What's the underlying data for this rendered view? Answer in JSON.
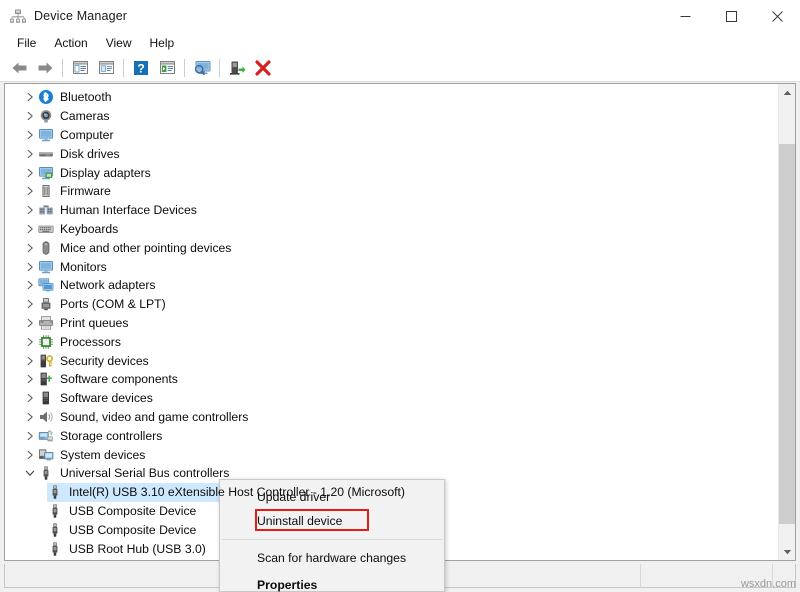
{
  "window": {
    "title": "Device Manager",
    "icon": "device-manager-icon",
    "controls": {
      "minimize": "minimize-icon",
      "maximize": "maximize-icon",
      "close": "close-icon"
    }
  },
  "menubar": {
    "items": [
      {
        "label": "File"
      },
      {
        "label": "Action"
      },
      {
        "label": "View"
      },
      {
        "label": "Help"
      }
    ]
  },
  "toolbar": {
    "buttons": [
      {
        "name": "back-icon"
      },
      {
        "name": "forward-icon"
      },
      {
        "name": "separator"
      },
      {
        "name": "properties-icon"
      },
      {
        "name": "help-topics-icon"
      },
      {
        "name": "separator"
      },
      {
        "name": "help-icon"
      },
      {
        "name": "update-driver-icon"
      },
      {
        "name": "separator"
      },
      {
        "name": "scan-hardware-changes-icon"
      },
      {
        "name": "separator"
      },
      {
        "name": "enable-device-icon"
      },
      {
        "name": "uninstall-device-icon"
      }
    ]
  },
  "tree": {
    "nodes": [
      {
        "label": "Bluetooth",
        "icon": "bluetooth-icon",
        "expand": "collapsed",
        "level": 1,
        "selected": false
      },
      {
        "label": "Cameras",
        "icon": "camera-icon",
        "expand": "collapsed",
        "level": 1,
        "selected": false
      },
      {
        "label": "Computer",
        "icon": "computer-icon",
        "expand": "collapsed",
        "level": 1,
        "selected": false
      },
      {
        "label": "Disk drives",
        "icon": "disk-drive-icon",
        "expand": "collapsed",
        "level": 1,
        "selected": false
      },
      {
        "label": "Display adapters",
        "icon": "display-adapter-icon",
        "expand": "collapsed",
        "level": 1,
        "selected": false
      },
      {
        "label": "Firmware",
        "icon": "firmware-icon",
        "expand": "collapsed",
        "level": 1,
        "selected": false
      },
      {
        "label": "Human Interface Devices",
        "icon": "hid-icon",
        "expand": "collapsed",
        "level": 1,
        "selected": false
      },
      {
        "label": "Keyboards",
        "icon": "keyboard-icon",
        "expand": "collapsed",
        "level": 1,
        "selected": false
      },
      {
        "label": "Mice and other pointing devices",
        "icon": "mouse-icon",
        "expand": "collapsed",
        "level": 1,
        "selected": false
      },
      {
        "label": "Monitors",
        "icon": "monitor-icon",
        "expand": "collapsed",
        "level": 1,
        "selected": false
      },
      {
        "label": "Network adapters",
        "icon": "network-adapter-icon",
        "expand": "collapsed",
        "level": 1,
        "selected": false
      },
      {
        "label": "Ports (COM & LPT)",
        "icon": "port-icon",
        "expand": "collapsed",
        "level": 1,
        "selected": false
      },
      {
        "label": "Print queues",
        "icon": "printer-icon",
        "expand": "collapsed",
        "level": 1,
        "selected": false
      },
      {
        "label": "Processors",
        "icon": "processor-icon",
        "expand": "collapsed",
        "level": 1,
        "selected": false
      },
      {
        "label": "Security devices",
        "icon": "security-device-icon",
        "expand": "collapsed",
        "level": 1,
        "selected": false
      },
      {
        "label": "Software components",
        "icon": "software-component-icon",
        "expand": "collapsed",
        "level": 1,
        "selected": false
      },
      {
        "label": "Software devices",
        "icon": "software-device-icon",
        "expand": "collapsed",
        "level": 1,
        "selected": false
      },
      {
        "label": "Sound, video and game controllers",
        "icon": "sound-device-icon",
        "expand": "collapsed",
        "level": 1,
        "selected": false
      },
      {
        "label": "Storage controllers",
        "icon": "storage-controller-icon",
        "expand": "collapsed",
        "level": 1,
        "selected": false
      },
      {
        "label": "System devices",
        "icon": "system-device-icon",
        "expand": "collapsed",
        "level": 1,
        "selected": false
      },
      {
        "label": "Universal Serial Bus controllers",
        "icon": "usb-icon",
        "expand": "expanded",
        "level": 1,
        "selected": false
      },
      {
        "label": "Intel(R) USB 3.10 eXtensible Host Controller - 1.20 (Microsoft)",
        "icon": "usb-icon",
        "expand": "none",
        "level": 2,
        "selected": true
      },
      {
        "label": "USB Composite Device",
        "icon": "usb-icon",
        "expand": "none",
        "level": 2,
        "selected": false
      },
      {
        "label": "USB Composite Device",
        "icon": "usb-icon",
        "expand": "none",
        "level": 2,
        "selected": false
      },
      {
        "label": "USB Root Hub (USB 3.0)",
        "icon": "usb-icon",
        "expand": "none",
        "level": 2,
        "selected": false
      }
    ]
  },
  "context_menu": {
    "items": [
      {
        "label": "Update driver",
        "bold": false,
        "highlighted": false
      },
      {
        "label": "Uninstall device",
        "bold": false,
        "highlighted": true
      },
      {
        "label": "Scan for hardware changes",
        "bold": false,
        "highlighted": false
      },
      {
        "label": "Properties",
        "bold": true,
        "highlighted": false
      }
    ],
    "highlight_color": "#e21b1b"
  },
  "statusbar": {
    "panels": [
      "",
      "",
      "",
      ""
    ]
  },
  "watermark": {
    "text": "wsxdn.com"
  },
  "colors": {
    "selection": "#cde8ff",
    "annotation": "#e21b1b",
    "window_bg": "#f0f0f0",
    "pane_bg": "#ffffff"
  }
}
